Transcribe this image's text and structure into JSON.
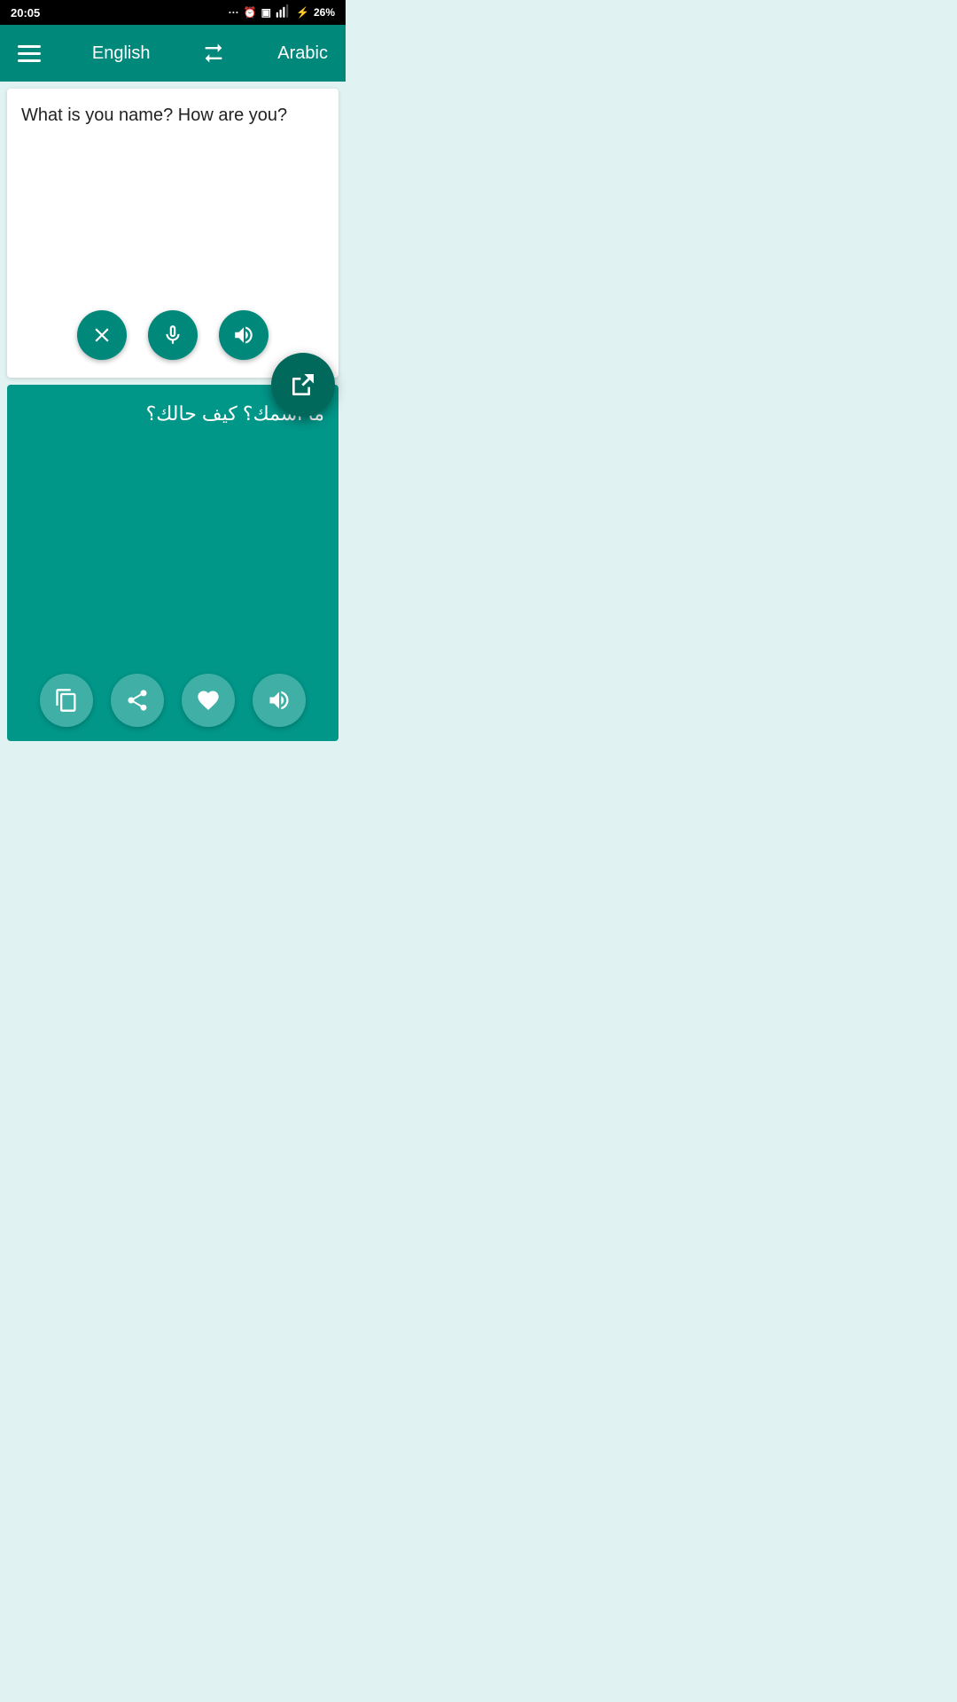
{
  "statusBar": {
    "time": "20:05",
    "battery": "26%",
    "icons": "... ⏰ ▣ ▲ ⚡"
  },
  "toolbar": {
    "menuLabel": "menu",
    "sourceLang": "English",
    "swapLabel": "swap languages",
    "targetLang": "Arabic"
  },
  "inputSection": {
    "inputText": "What is you name? How are you?",
    "clearLabel": "Clear",
    "micLabel": "Microphone",
    "speakLabel": "Speak input"
  },
  "fab": {
    "label": "Translate"
  },
  "outputSection": {
    "outputText": "ما اسمك؟ كيف حالك؟",
    "copyLabel": "Copy",
    "shareLabel": "Share",
    "favoriteLabel": "Favorite",
    "speakLabel": "Speak output"
  }
}
